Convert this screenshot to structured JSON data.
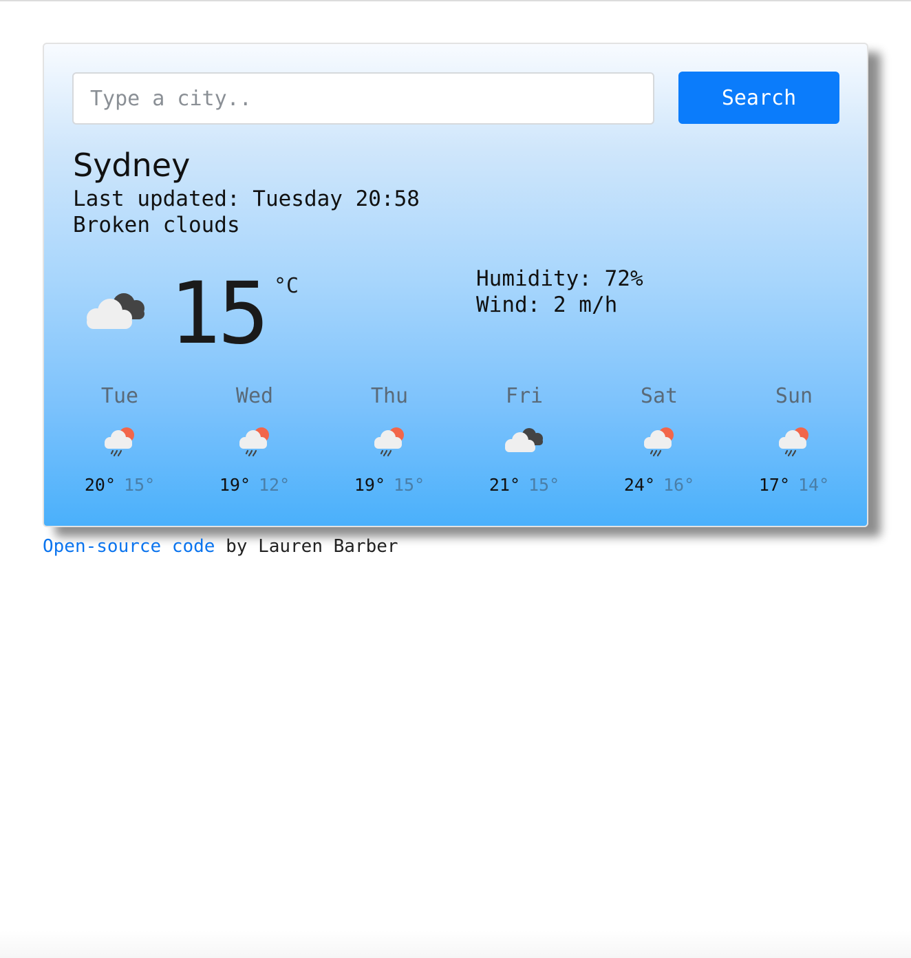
{
  "search": {
    "placeholder": "Type a city..",
    "button_label": "Search"
  },
  "current": {
    "city": "Sydney",
    "last_updated": "Last updated: Tuesday 20:58",
    "description": "Broken clouds",
    "icon": "broken-clouds-icon",
    "temperature": "15",
    "unit": "°C",
    "humidity": "Humidity: 72%",
    "wind": "Wind: 2 m/h"
  },
  "forecast": [
    {
      "day": "Tue",
      "icon": "rain-sun-icon",
      "max": "20°",
      "min": "15°"
    },
    {
      "day": "Wed",
      "icon": "rain-sun-icon",
      "max": "19°",
      "min": "12°"
    },
    {
      "day": "Thu",
      "icon": "rain-sun-icon",
      "max": "19°",
      "min": "15°"
    },
    {
      "day": "Fri",
      "icon": "broken-clouds-icon",
      "max": "21°",
      "min": "15°"
    },
    {
      "day": "Sat",
      "icon": "rain-sun-icon",
      "max": "24°",
      "min": "16°"
    },
    {
      "day": "Sun",
      "icon": "rain-sun-icon",
      "max": "17°",
      "min": "14°"
    }
  ],
  "footer": {
    "link_text": "Open-source code",
    "suffix_text": " by Lauren Barber"
  },
  "colors": {
    "button": "#0b7cfb",
    "link": "#0b74ee",
    "sun": "#f2664a",
    "cloud_light": "#efefef",
    "cloud_dark": "#444444"
  }
}
